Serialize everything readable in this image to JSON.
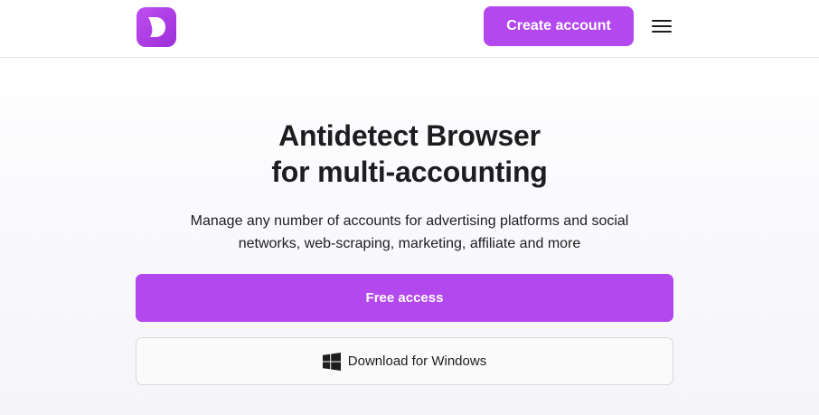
{
  "header": {
    "logo_letter": "D",
    "create_account_label": "Create account",
    "menu_icon": "hamburger-icon"
  },
  "hero": {
    "title_line1": "Antidetect Browser",
    "title_line2": "for multi-accounting",
    "subtitle_line1": "Manage any number of accounts for advertising platforms and social",
    "subtitle_line2": "networks, web-scraping, marketing, affiliate and more",
    "free_access_label": "Free access",
    "download_label": "Download for Windows",
    "download_icon": "windows-icon"
  },
  "colors": {
    "accent": "#b348ee",
    "text": "#1d1d1f",
    "border": "#d9d9de"
  }
}
